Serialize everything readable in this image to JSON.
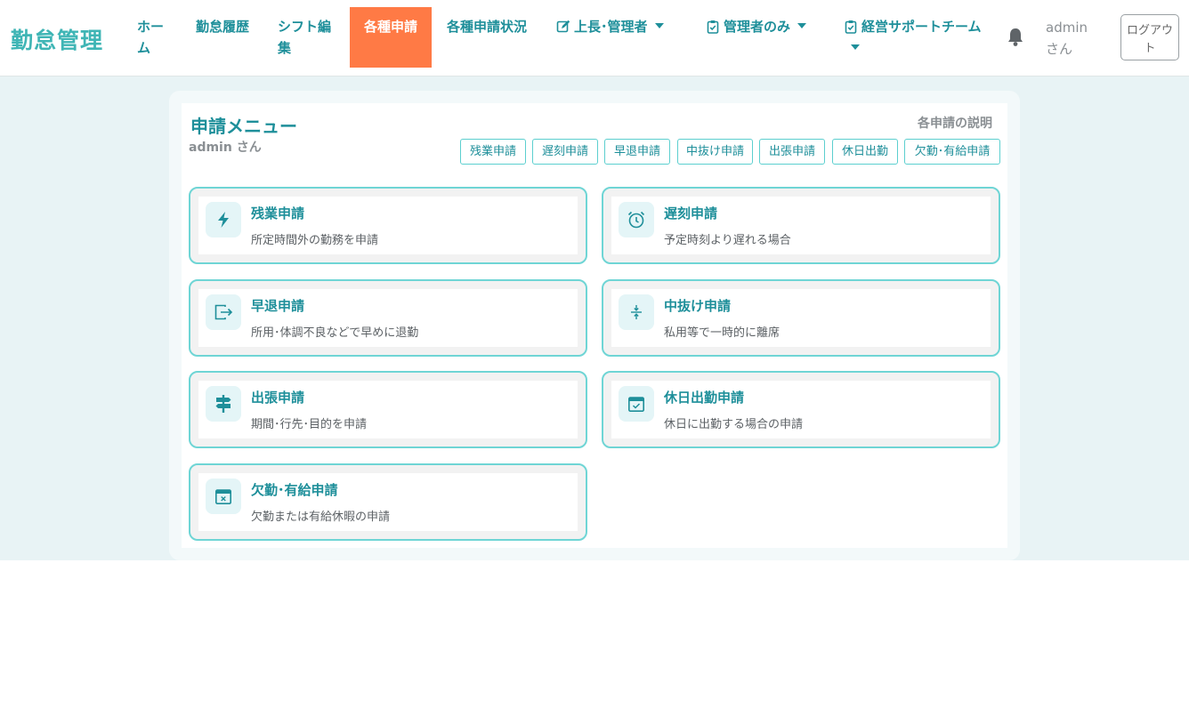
{
  "brand": "勤怠管理",
  "nav": {
    "home": "ホーム",
    "history": "勤怠履歴",
    "shift": "シフト編集",
    "requests": "各種申請",
    "request_status": "各種申請状況",
    "boss_admin": "上長･管理者",
    "admin_only": "管理者のみ",
    "mgmt_support": "経営サポートチーム"
  },
  "user_label": "admin さん",
  "logout": "ログアウト",
  "menu": {
    "title": "申請メニュー",
    "user": "admin さん",
    "explain": "各申請の説明"
  },
  "chips": [
    "残業申請",
    "遅刻申請",
    "早退申請",
    "中抜け申請",
    "出張申請",
    "休日出勤",
    "欠勤･有給申請"
  ],
  "cards": [
    {
      "title": "残業申請",
      "desc": "所定時間外の勤務を申請",
      "icon": "lightning-icon"
    },
    {
      "title": "遅刻申請",
      "desc": "予定時刻より遅れる場合",
      "icon": "alarm-clock-icon"
    },
    {
      "title": "早退申請",
      "desc": "所用･体調不良などで早めに退勤",
      "icon": "exit-icon"
    },
    {
      "title": "中抜け申請",
      "desc": "私用等で一時的に離席",
      "icon": "collapse-vertical-icon"
    },
    {
      "title": "出張申請",
      "desc": "期間･行先･目的を申請",
      "icon": "signpost-icon"
    },
    {
      "title": "休日出勤申請",
      "desc": "休日に出勤する場合の申請",
      "icon": "calendar-check-icon"
    },
    {
      "title": "欠勤･有給申請",
      "desc": "欠勤または有給休暇の申請",
      "icon": "calendar-x-icon"
    }
  ],
  "colors": {
    "brand": "#3fb5b5",
    "accent": "#1e8f9a",
    "active_tab": "#ff7a45",
    "card_border": "#6fd5d5",
    "band": "#e8f3f5"
  }
}
